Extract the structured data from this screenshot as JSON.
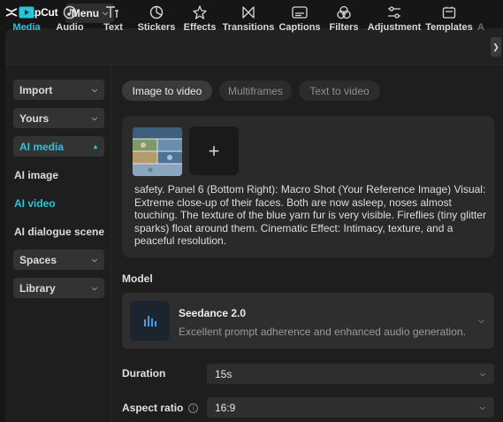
{
  "app": {
    "logo_text": "CapCut",
    "menu_label": "Menu"
  },
  "toolbar": {
    "items": [
      {
        "label": "Media",
        "icon": "media-play-icon",
        "active": true
      },
      {
        "label": "Audio",
        "icon": "audio-note-icon"
      },
      {
        "label": "Text",
        "icon": "text-t-icon"
      },
      {
        "label": "Stickers",
        "icon": "sticker-icon"
      },
      {
        "label": "Effects",
        "icon": "effects-star-icon"
      },
      {
        "label": "Transitions",
        "icon": "transition-bowtie-icon"
      },
      {
        "label": "Captions",
        "icon": "captions-icon"
      },
      {
        "label": "Filters",
        "icon": "filters-circles-icon"
      },
      {
        "label": "Adjustment",
        "icon": "adjustment-sliders-icon"
      },
      {
        "label": "Templates",
        "icon": "templates-icon"
      },
      {
        "label": "A",
        "icon": ""
      }
    ]
  },
  "sidebar": {
    "import": "Import",
    "yours": "Yours",
    "ai_media": "AI media",
    "ai_image": "AI image",
    "ai_video": "AI video",
    "ai_dialogue": "AI dialogue scene",
    "spaces": "Spaces",
    "library": "Library"
  },
  "tabs": {
    "image_to_video": "Image to video",
    "multiframes": "Multiframes",
    "text_to_video": "Text to video"
  },
  "prompt": {
    "text": "safety. Panel 6 (Bottom Right): Macro Shot (Your Reference Image) Visual: Extreme close-up of their faces. Both are now asleep, noses almost touching. The texture of the blue yarn fur is very visible. Fireflies (tiny glitter sparks) float around them. Cinematic Effect: Intimacy, texture, and a peaceful resolution."
  },
  "model": {
    "section_label": "Model",
    "name": "Seedance 2.0",
    "description": "Excellent prompt adherence and enhanced audio generation."
  },
  "settings": {
    "duration_label": "Duration",
    "duration_value": "15s",
    "aspect_label": "Aspect ratio",
    "aspect_value": "16:9"
  },
  "colors": {
    "accent": "#26c6da",
    "background": "#1e1e1e",
    "surface": "#2e2e2e"
  }
}
